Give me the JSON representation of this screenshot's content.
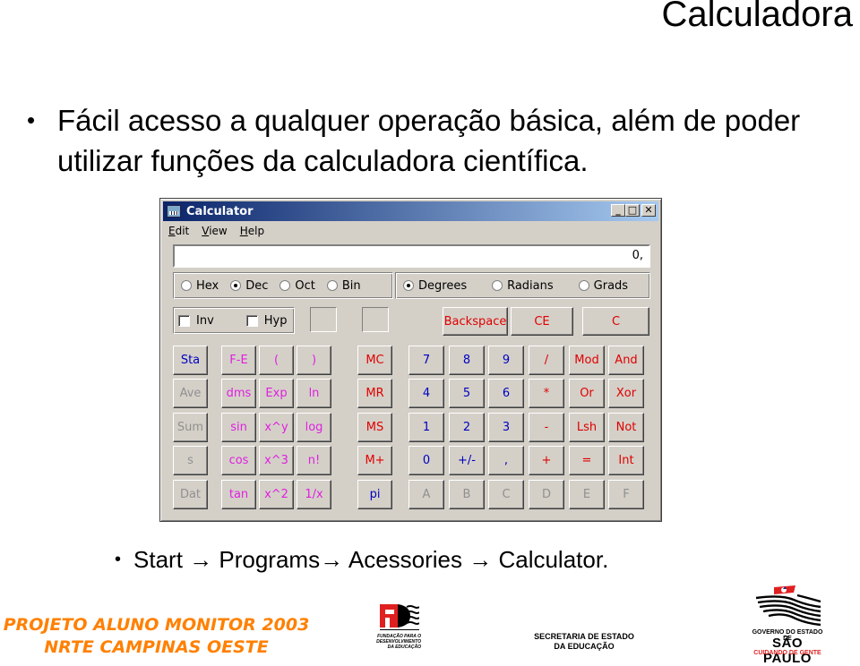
{
  "slide": {
    "title": "Calculadora",
    "bullet_main": "Fácil acesso a qualquer operação básica, além de poder utilizar funções da calculadora científica.",
    "bullet_sub": "Start → Programs→ Acessories → Calculator.",
    "bullet_glyph": "•"
  },
  "window": {
    "title": "Calculator",
    "controls": {
      "minimize": "_",
      "maximize": "□",
      "close": "✕"
    },
    "menu": [
      "Edit",
      "View",
      "Help"
    ],
    "display_value": "0,",
    "base_options": [
      {
        "label": "Hex",
        "selected": false
      },
      {
        "label": "Dec",
        "selected": true
      },
      {
        "label": "Oct",
        "selected": false
      },
      {
        "label": "Bin",
        "selected": false
      }
    ],
    "angle_options": [
      {
        "label": "Degrees",
        "selected": true
      },
      {
        "label": "Radians",
        "selected": false
      },
      {
        "label": "Grads",
        "selected": false
      }
    ],
    "checkboxes": [
      {
        "label": "Inv",
        "checked": false
      },
      {
        "label": "Hyp",
        "checked": false
      }
    ],
    "edit_buttons": [
      "Backspace",
      "CE",
      "C"
    ],
    "stat_buttons": [
      "Sta",
      "Ave",
      "Sum",
      "s",
      "Dat"
    ],
    "sci_buttons": [
      [
        "F-E",
        "(",
        ")"
      ],
      [
        "dms",
        "Exp",
        "ln"
      ],
      [
        "sin",
        "x^y",
        "log"
      ],
      [
        "cos",
        "x^3",
        "n!"
      ],
      [
        "tan",
        "x^2",
        "1/x"
      ]
    ],
    "mem_buttons": [
      "MC",
      "MR",
      "MS",
      "M+",
      "pi"
    ],
    "main_buttons": [
      [
        "7",
        "8",
        "9",
        "/",
        "Mod",
        "And"
      ],
      [
        "4",
        "5",
        "6",
        "*",
        "Or",
        "Xor"
      ],
      [
        "1",
        "2",
        "3",
        "-",
        "Lsh",
        "Not"
      ],
      [
        "0",
        "+/-",
        ",",
        "+",
        "=",
        "Int"
      ],
      [
        "A",
        "B",
        "C",
        "D",
        "E",
        "F"
      ]
    ],
    "colors": {
      "red": "#e00000",
      "blue": "#0000c0",
      "magenta": "#e020e0",
      "disabled": "#909090",
      "face": "#d4d0c8",
      "title_start": "#0a246a",
      "title_end": "#a6caf0"
    }
  },
  "footer": {
    "project_line1": "PROJETO ALUNO MONITOR 2003",
    "project_line2": "NRTE CAMPINAS OESTE",
    "fde_text": "FUNDAÇÃO PARA O DESENVOLVIMENTO DA EDUCAÇÃO",
    "secretaria_line1": "SECRETARIA DE ESTADO",
    "secretaria_line2": "DA EDUCAÇÃO",
    "sp_line1": "GOVERNO DO ESTADO DE",
    "sp_line2": "SÃO PAULO",
    "sp_line3": "CUIDANDO DE GENTE"
  }
}
